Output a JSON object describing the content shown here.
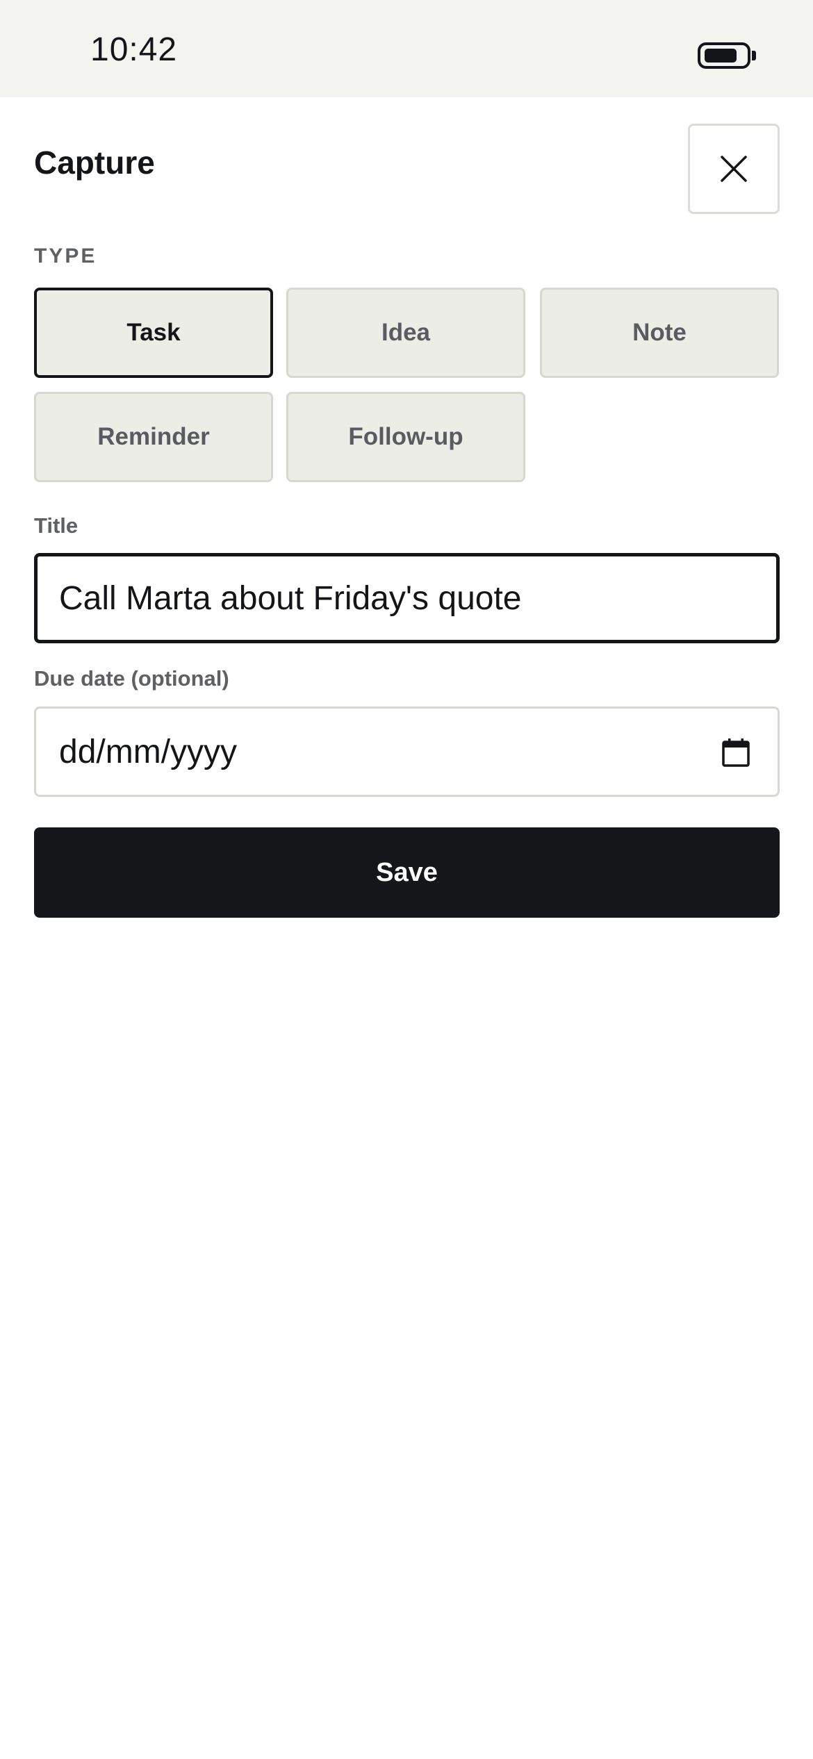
{
  "status_bar": {
    "time": "10:42",
    "battery_icon": "battery-icon"
  },
  "sheet": {
    "title": "Capture",
    "close_icon": "close-icon"
  },
  "type_section": {
    "label": "TYPE",
    "options": [
      {
        "label": "Task",
        "selected": true
      },
      {
        "label": "Idea",
        "selected": false
      },
      {
        "label": "Note",
        "selected": false
      },
      {
        "label": "Reminder",
        "selected": false
      },
      {
        "label": "Follow-up",
        "selected": false
      }
    ]
  },
  "title_field": {
    "label": "Title",
    "value": "Call Marta about Friday's quote"
  },
  "due_date_field": {
    "label": "Due date (optional)",
    "placeholder": "dd/mm/yyyy",
    "icon": "calendar-icon"
  },
  "save_label": "Save",
  "colors": {
    "status_bar_bg": "#f3f3ef",
    "option_bg": "#ededE8",
    "primary": "#151619",
    "muted_text": "#5f6064"
  }
}
